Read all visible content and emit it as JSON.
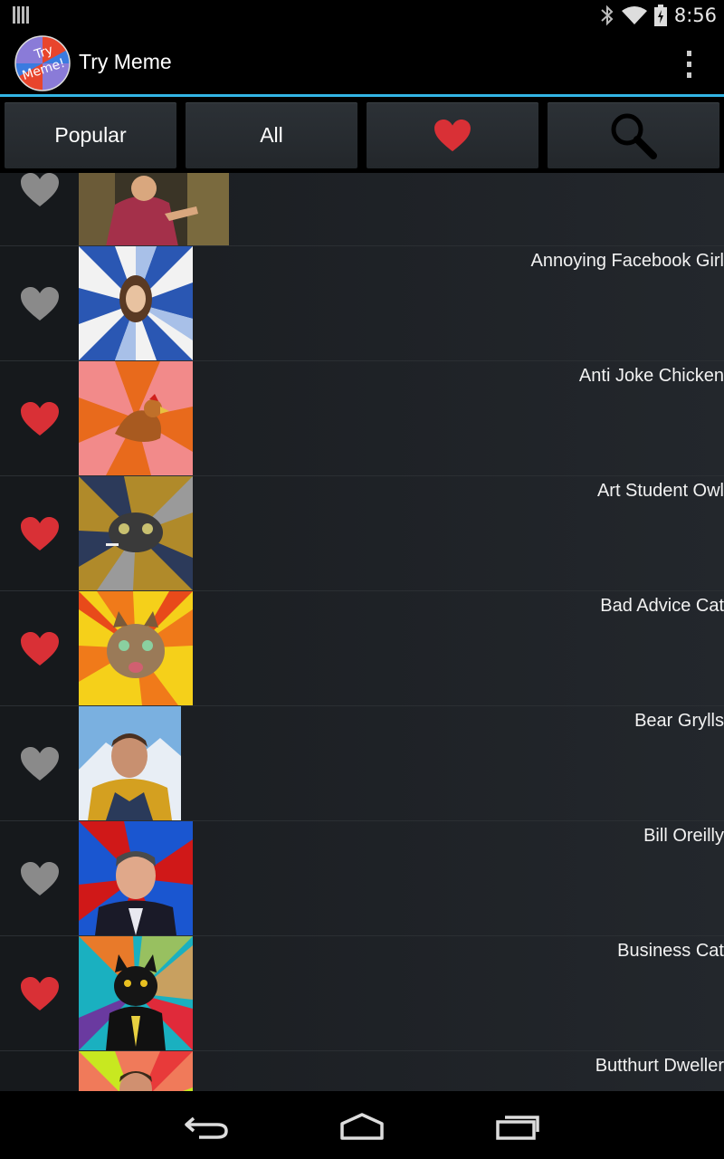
{
  "status_bar": {
    "time": "8:56",
    "icons": [
      "notification-bars-icon",
      "bluetooth-icon",
      "wifi-icon",
      "battery-icon"
    ]
  },
  "action_bar": {
    "title": "Try Meme",
    "logo_text": "Try Meme!",
    "accent_color": "#33b5e5"
  },
  "tabs": [
    {
      "label": "Popular"
    },
    {
      "label": "All"
    },
    {
      "label": "",
      "icon": "heart-icon"
    },
    {
      "label": "",
      "icon": "search-icon"
    }
  ],
  "memes": [
    {
      "name": "",
      "favorite": false
    },
    {
      "name": "Annoying Facebook Girl",
      "favorite": false
    },
    {
      "name": "Anti Joke Chicken",
      "favorite": true
    },
    {
      "name": "Art Student Owl",
      "favorite": true
    },
    {
      "name": "Bad Advice Cat",
      "favorite": true
    },
    {
      "name": "Bear Grylls",
      "favorite": false
    },
    {
      "name": "Bill Oreilly",
      "favorite": false
    },
    {
      "name": "Business Cat",
      "favorite": true
    },
    {
      "name": "Butthurt Dweller",
      "favorite": false
    }
  ],
  "colors": {
    "favorite_on": "#d93036",
    "favorite_off": "#8a8a8a"
  },
  "nav_bar": {
    "buttons": [
      "back-icon",
      "home-icon",
      "recent-apps-icon"
    ]
  }
}
